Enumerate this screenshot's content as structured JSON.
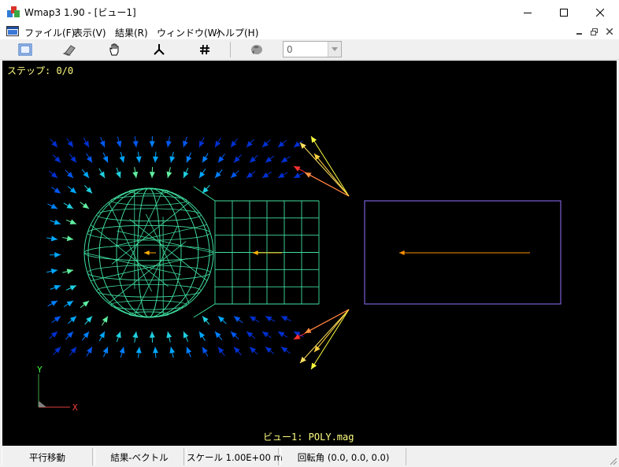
{
  "window": {
    "title": "Wmap3 1.90 - [ビュー1]"
  },
  "menu": {
    "items": [
      "ファイル(F)",
      "表示(V)",
      "結果(R)",
      "ウィンドウ(W)",
      "ヘルプ(H)"
    ]
  },
  "toolbar": {
    "tools": [
      "view-frame-icon",
      "eraser-icon",
      "hand-pan-icon",
      "axes-icon",
      "grid-hash-icon",
      "rotate-globe-icon"
    ],
    "step_value": "0"
  },
  "viewport": {
    "step_text": "ステップ: 0/0",
    "view_text": "ビュー1: POLY.mag",
    "axis_y": "Y",
    "axis_x": "X",
    "colors": {
      "background": "#000000",
      "mesh": "#40e0a0",
      "label": "#ffff80",
      "box": "#9070ff"
    }
  },
  "status": {
    "mode": "平行移動",
    "result": "結果-ベクトル",
    "scale": "スケール 1.00E+00 m",
    "rotation": "回転角 (0.0, 0.0, 0.0)"
  }
}
